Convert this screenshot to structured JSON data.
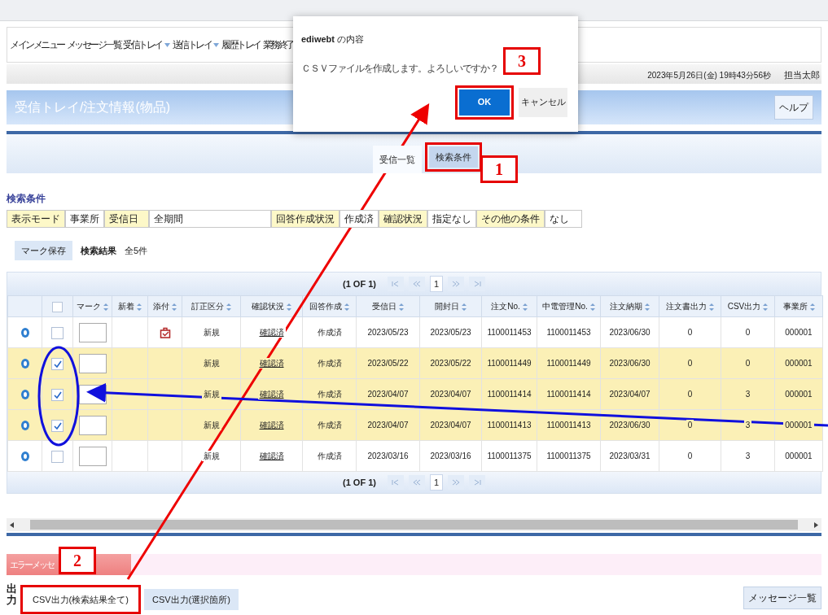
{
  "nav_menu": [
    {
      "label": "メインメニュー",
      "has_menu": false
    },
    {
      "label": "メッセージ一覧",
      "has_menu": false
    },
    {
      "label": "受信トレイ",
      "has_menu": true
    },
    {
      "label": "送信トレイ",
      "has_menu": true
    },
    {
      "label": "履歴トレイ",
      "has_menu": false
    },
    {
      "label": "業務終了",
      "has_menu": false
    }
  ],
  "status": {
    "datetime": "2023年5月26日(金) 19時43分56秒",
    "user": "担当太郎"
  },
  "page_title": "受信トレイ/注文情報(物品)",
  "help_button": "ヘルプ",
  "tabs": [
    {
      "label": "受信一覧",
      "selected": true,
      "highlighted": false
    },
    {
      "label": "検索条件",
      "selected": false,
      "highlighted": true
    }
  ],
  "search_conditions": {
    "heading": "検索条件",
    "items": [
      {
        "label": "表示モード",
        "value": "事業所"
      },
      {
        "label": "受信日",
        "value": "全期間"
      },
      {
        "label": "回答作成状況",
        "value": "作成済"
      },
      {
        "label": "確認状況",
        "value": "指定なし"
      },
      {
        "label": "その他の条件",
        "value": "なし"
      }
    ]
  },
  "results": {
    "mark_save_button": "マーク保存",
    "label": "検索結果",
    "count": "全5件"
  },
  "pager_top": {
    "summary": "(1 OF 1)",
    "page": "1"
  },
  "table": {
    "header_checked": false,
    "columns": [
      "マーク",
      "新着",
      "添付",
      "訂正区分",
      "確認状況",
      "回答作成",
      "受信日",
      "開封日",
      "注文No.",
      "中電管理No.",
      "注文納期",
      "注文書出力",
      "CSV出力",
      "事業所"
    ],
    "rows": [
      {
        "selected": false,
        "checked": false,
        "attachment": true,
        "correction": "新規",
        "confirm": "確認済",
        "reply": "作成済",
        "received": "2023/05/23",
        "opened": "2023/05/23",
        "order_no": "1100011453",
        "chuden_no": "1100011453",
        "due": "2023/06/30",
        "print_count": "0",
        "csv_count": "0",
        "office": "000001"
      },
      {
        "selected": true,
        "checked": true,
        "attachment": false,
        "correction": "新規",
        "confirm": "確認済",
        "reply": "作成済",
        "received": "2023/05/22",
        "opened": "2023/05/22",
        "order_no": "1100011449",
        "chuden_no": "1100011449",
        "due": "2023/06/30",
        "print_count": "0",
        "csv_count": "0",
        "office": "000001"
      },
      {
        "selected": true,
        "checked": true,
        "attachment": false,
        "correction": "新規",
        "confirm": "確認済",
        "reply": "作成済",
        "received": "2023/04/07",
        "opened": "2023/04/07",
        "order_no": "1100011414",
        "chuden_no": "1100011414",
        "due": "2023/04/07",
        "print_count": "0",
        "csv_count": "3",
        "office": "000001"
      },
      {
        "selected": true,
        "checked": true,
        "attachment": false,
        "correction": "新規",
        "confirm": "確認済",
        "reply": "作成済",
        "received": "2023/04/07",
        "opened": "2023/04/07",
        "order_no": "1100011413",
        "chuden_no": "1100011413",
        "due": "2023/06/30",
        "print_count": "0",
        "csv_count": "3",
        "office": "000001"
      },
      {
        "selected": false,
        "checked": false,
        "attachment": false,
        "correction": "新規",
        "confirm": "確認済",
        "reply": "作成済",
        "received": "2023/03/16",
        "opened": "2023/03/16",
        "order_no": "1100011375",
        "chuden_no": "1100011375",
        "due": "2023/03/31",
        "print_count": "0",
        "csv_count": "3",
        "office": "000001"
      }
    ]
  },
  "pager_bottom": {
    "summary": "(1 OF 1)",
    "page": "1"
  },
  "error_label": "エラーメッセ",
  "output": {
    "label": "出力",
    "buttons": [
      {
        "label": "CSV出力(検索結果全て)",
        "highlighted": true
      },
      {
        "label": "CSV出力(選択箇所)",
        "highlighted": false
      }
    ],
    "message_list_button": "メッセージ一覧"
  },
  "dialog": {
    "title": "**ediwebt** の内容",
    "message": "ＣＳＶファイルを作成します。よろしいですか？",
    "ok": "OK",
    "ok_highlighted": true,
    "cancel": "キャンセル"
  },
  "annotations": [
    {
      "label": "1"
    },
    {
      "label": "2"
    },
    {
      "label": "3"
    }
  ]
}
